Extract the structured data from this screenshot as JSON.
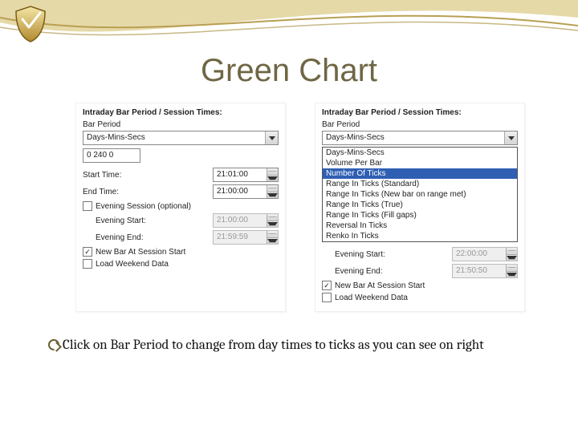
{
  "logo": {
    "type": "shield-icon"
  },
  "title": "Green Chart",
  "panel_left": {
    "header": "Intraday Bar Period / Session Times:",
    "bar_period_label": "Bar Period",
    "combo_value": "Days-Mins-Secs",
    "dms_value": "0 240 0",
    "start_time_label": "Start Time:",
    "start_time_value": "21:01:00",
    "end_time_label": "End Time:",
    "end_time_value": "21:00:00",
    "evening_session_label": "Evening Session (optional)",
    "evening_session_checked": false,
    "evening_start_label": "Evening Start:",
    "evening_start_value": "21:00:00",
    "evening_end_label": "Evening End:",
    "evening_end_value": "21:59:59",
    "new_bar_label": "New Bar At Session Start",
    "new_bar_checked": true,
    "load_weekend_label": "Load Weekend Data",
    "load_weekend_checked": false
  },
  "panel_right": {
    "header": "Intraday Bar Period / Session Times:",
    "bar_period_label": "Bar Period",
    "combo_value": "Days-Mins-Secs",
    "options": [
      "Days-Mins-Secs",
      "Volume Per Bar",
      "Number Of Ticks",
      "Range In Ticks (Standard)",
      "Range In Ticks (New bar on range met)",
      "Range In Ticks (True)",
      "Range In Ticks (Fill gaps)",
      "Reversal In Ticks",
      "Renko In Ticks"
    ],
    "highlight_index": 2,
    "evening_start_label": "Evening Start:",
    "evening_start_value": "22:00:00",
    "evening_end_label": "Evening End:",
    "evening_end_value": "21:50:50",
    "new_bar_label": "New Bar At Session Start",
    "new_bar_checked": true,
    "load_weekend_label": "Load Weekend Data",
    "load_weekend_checked": false
  },
  "bullet_text": "Click on Bar Period to change from day times to ticks as you can see on right"
}
